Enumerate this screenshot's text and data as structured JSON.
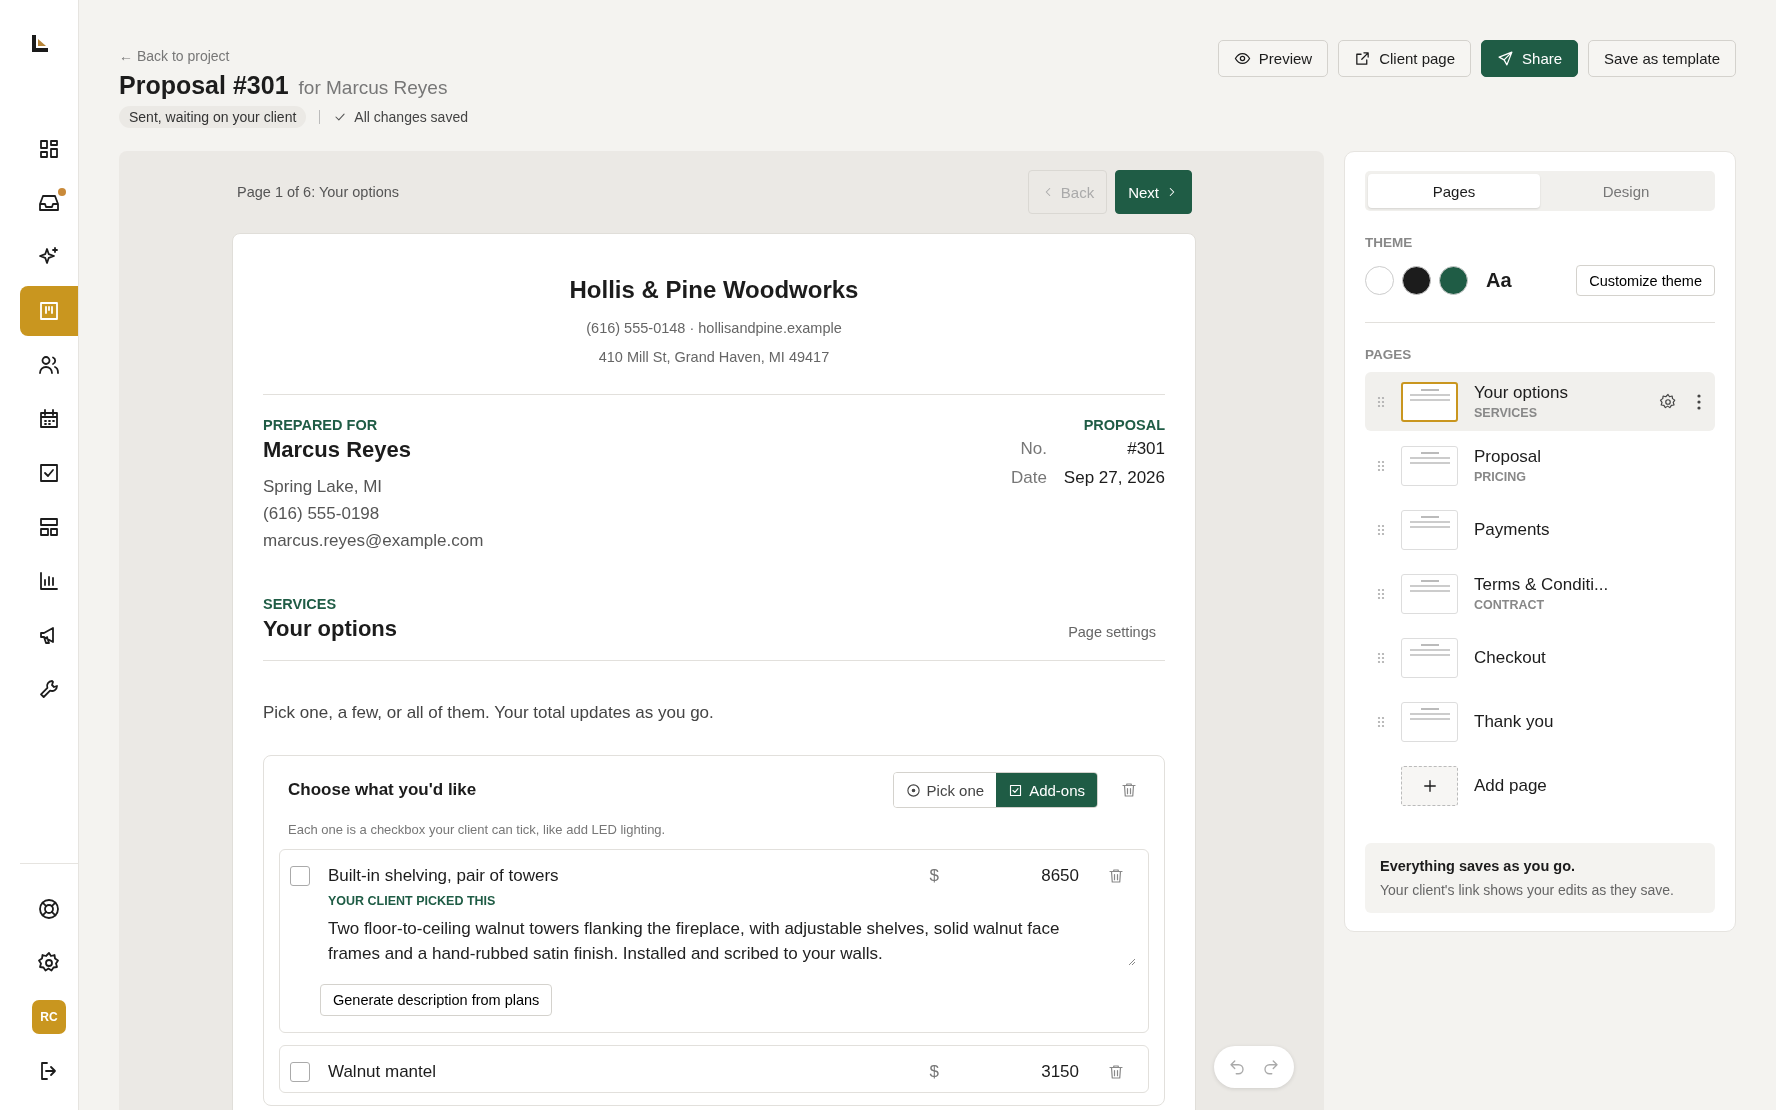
{
  "sidebar": {
    "nav": [
      {
        "selected": false,
        "badge": false
      },
      {
        "selected": false,
        "badge": true
      },
      {
        "selected": false,
        "badge": false
      },
      {
        "selected": true,
        "badge": false
      },
      {
        "selected": false,
        "badge": false
      },
      {
        "selected": false,
        "badge": false
      },
      {
        "selected": false,
        "badge": false
      },
      {
        "selected": false,
        "badge": false
      },
      {
        "selected": false,
        "badge": false
      },
      {
        "selected": false,
        "badge": false
      },
      {
        "selected": false,
        "badge": false
      }
    ],
    "avatar": "RC"
  },
  "header": {
    "back_link": "← Back to project",
    "title": "Proposal #301",
    "subtitle": "for Marcus Reyes",
    "status": "Sent, waiting on your client",
    "save_state": "All changes saved",
    "actions": [
      {
        "label": "Preview",
        "kind": "secondary"
      },
      {
        "label": "Client page",
        "kind": "secondary"
      },
      {
        "label": "Share",
        "kind": "primary"
      },
      {
        "label": "Save as template",
        "kind": "secondary"
      }
    ]
  },
  "page_nav": {
    "label": "Page 1 of 6: Your options",
    "back": {
      "label": "Back",
      "disabled": true
    },
    "next": {
      "label": "Next",
      "disabled": false
    }
  },
  "document": {
    "company": {
      "name": "Hollis & Pine Woodworks",
      "contact": "(616) 555-0148 · hollisandpine.example",
      "address": "410 Mill St, Grand Haven, MI 49417"
    },
    "prepared_for": {
      "heading": "PREPARED FOR",
      "name": "Marcus Reyes",
      "lines": [
        "Spring Lake, MI",
        "(616) 555-0198",
        "marcus.reyes@example.com"
      ]
    },
    "proposal": {
      "heading": "PROPOSAL",
      "fields": [
        {
          "label": "No.",
          "value": "#301"
        },
        {
          "label": "Date",
          "value": "Sep 27, 2026"
        }
      ]
    },
    "section": {
      "eyebrow": "SERVICES",
      "title": "Your options",
      "settings_link": "Page settings"
    },
    "intro": "Pick one, a few, or all of them. Your total updates as you go.",
    "block": {
      "title": "Choose what you'd like",
      "modes": [
        {
          "label": "Pick one",
          "selected": false
        },
        {
          "label": "Add-ons",
          "selected": true
        }
      ],
      "hint": "Each one is a checkbox your client can tick, like add LED lighting.",
      "items": [
        {
          "name": "Built-in shelving, pair of towers",
          "checked": false,
          "currency": "$",
          "price": "8650",
          "tag": "YOUR CLIENT PICKED THIS",
          "description": "Two floor-to-ceiling walnut towers flanking the fireplace, with adjustable shelves, solid walnut face frames and a hand-rubbed satin finish. Installed and scribed to your walls.",
          "generate_button": "Generate description from plans"
        },
        {
          "name": "Walnut mantel",
          "checked": false,
          "currency": "$",
          "price": "3150"
        }
      ]
    }
  },
  "panel": {
    "tabs": [
      {
        "label": "Pages",
        "selected": true
      },
      {
        "label": "Design",
        "selected": false
      }
    ],
    "theme": {
      "heading": "THEME",
      "swatches": [
        {
          "color": "#ffffff"
        },
        {
          "color": "#1c1c1c"
        },
        {
          "color": "#1f5c45"
        }
      ],
      "font_sample": "Aa",
      "customize": "Customize theme"
    },
    "pages": {
      "heading": "PAGES",
      "items": [
        {
          "title": "Your options",
          "subtitle": "SERVICES",
          "selected": true
        },
        {
          "title": "Proposal",
          "subtitle": "PRICING",
          "selected": false
        },
        {
          "title": "Payments",
          "selected": false
        },
        {
          "title": "Terms & Conditi...",
          "subtitle": "CONTRACT",
          "selected": false
        },
        {
          "title": "Checkout",
          "selected": false
        },
        {
          "title": "Thank you",
          "selected": false
        }
      ],
      "add": "Add page"
    },
    "note": {
      "title": "Everything saves as you go.",
      "text": "Your client's link shows your edits as they save."
    }
  }
}
